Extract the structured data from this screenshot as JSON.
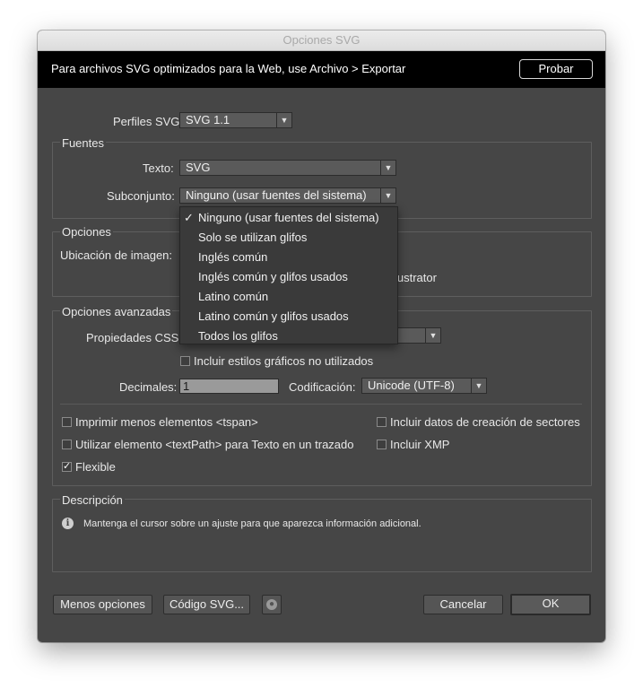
{
  "window": {
    "title": "Opciones SVG"
  },
  "banner": {
    "text": "Para archivos SVG optimizados para la Web, use Archivo > Exportar",
    "button": "Probar"
  },
  "profile": {
    "label": "Perfiles SVG",
    "value": "SVG 1.1"
  },
  "fonts": {
    "group_title": "Fuentes",
    "text_label": "Texto:",
    "text_value": "SVG",
    "subset_label": "Subconjunto:",
    "subset_value": "Ninguno (usar fuentes del sistema)"
  },
  "options": {
    "group_title": "Opciones",
    "image_location_label": "Ubicación de imagen:",
    "preserve_partial": "lustrator"
  },
  "advanced": {
    "group_title": "Opciones avanzadas",
    "css_label": "Propiedades CSS:",
    "unused_styles_label": "Incluir estilos gráficos no utilizados",
    "decimals_label": "Decimales:",
    "decimals_value": "1",
    "encoding_label": "Codificación:",
    "encoding_value": "Unicode (UTF-8)",
    "tspan_label": "Imprimir menos elementos <tspan>",
    "textpath_label": "Utilizar elemento <textPath> para Texto en un trazado",
    "responsive_label": "Flexible",
    "slicing_label": "Incluir datos de creación de sectores",
    "xmp_label": "Incluir XMP",
    "responsive_checked": true
  },
  "description": {
    "group_title": "Descripción",
    "text": "Mantenga el cursor sobre un ajuste para que aparezca información adicional."
  },
  "buttons": {
    "less_options": "Menos opciones",
    "svg_code": "Código SVG...",
    "cancel": "Cancelar",
    "ok": "OK"
  },
  "subset_dropdown": {
    "selected_index": 0,
    "check_glyph": "✓",
    "items": [
      "Ninguno (usar fuentes del sistema)",
      "Solo se utilizan glifos",
      "Inglés común",
      "Inglés común y glifos usados",
      "Latino común",
      "Latino común y glifos usados",
      "Todos los glifos"
    ]
  }
}
